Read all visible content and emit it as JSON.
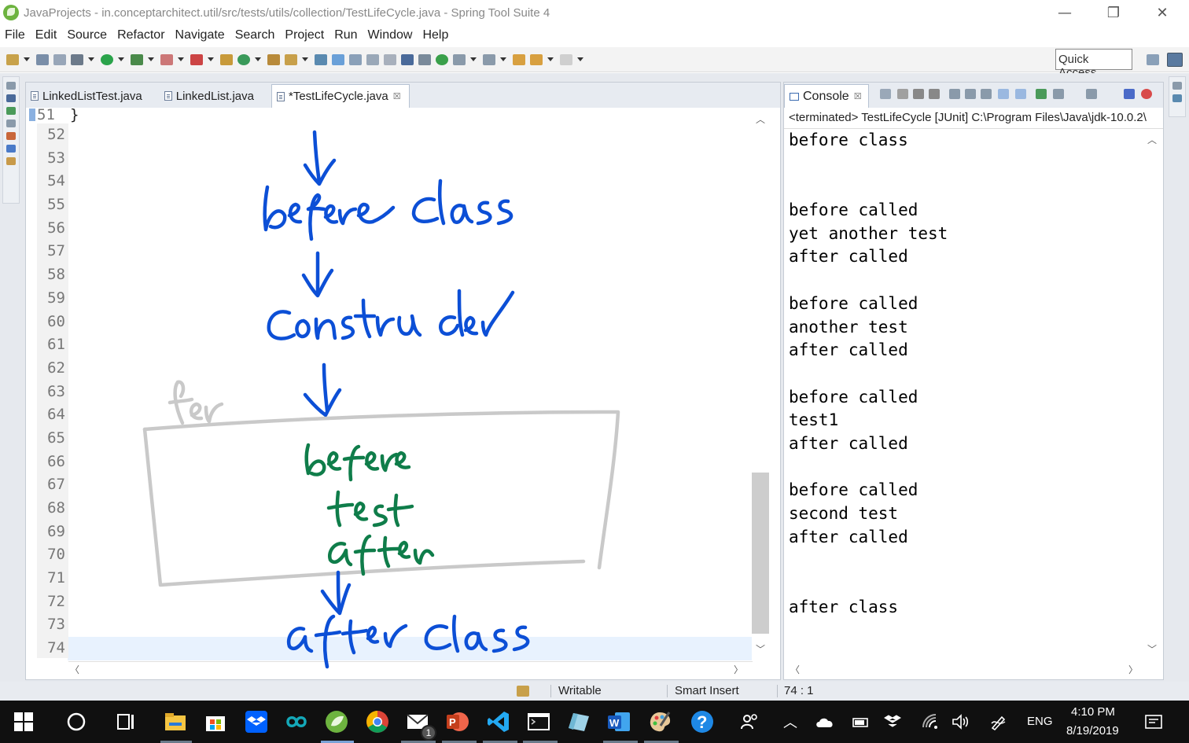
{
  "window": {
    "title": "JavaProjects - in.conceptarchitect.util/src/tests/utils/collection/TestLifeCycle.java - Spring Tool Suite 4",
    "minimize_glyph": "—",
    "restore_glyph": "❐",
    "close_glyph": "✕"
  },
  "menu": [
    "File",
    "Edit",
    "Source",
    "Refactor",
    "Navigate",
    "Search",
    "Project",
    "Run",
    "Window",
    "Help"
  ],
  "toolbar": {
    "quick_access": "Quick Access"
  },
  "editor": {
    "tabs": [
      {
        "label": "LinkedListTest.java"
      },
      {
        "label": "LinkedList.java"
      },
      {
        "label": "*TestLifeCycle.java"
      }
    ],
    "tab_close_glyph": "☒",
    "first_line_number": "51",
    "first_line_code": "}",
    "line_numbers": [
      "52",
      "53",
      "54",
      "55",
      "56",
      "57",
      "58",
      "59",
      "60",
      "61",
      "62",
      "63",
      "64",
      "65",
      "66",
      "67",
      "68",
      "69",
      "70",
      "71",
      "72",
      "73",
      "74"
    ]
  },
  "console": {
    "tab_label": "Console",
    "tab_close_glyph": "☒",
    "status": "<terminated> TestLifeCycle [JUnit] C:\\Program Files\\Java\\jdk-10.0.2\\",
    "lines": [
      "before class",
      "",
      "",
      "before called",
      "yet another test",
      "after called",
      "",
      "before called",
      "another test",
      "after called",
      "",
      "before called",
      "test1",
      "after called",
      "",
      "before called",
      "second test",
      "after called",
      "",
      "",
      "after class"
    ]
  },
  "statusbar": {
    "mode": "Writable",
    "insert": "Smart Insert",
    "position": "74 : 1"
  },
  "taskbar": {
    "time": "4:10 PM",
    "date": "8/19/2019",
    "language": "ENG",
    "badge": "1"
  },
  "colors": {
    "ink_blue": "#0c4fd6",
    "ink_green": "#0f7d4a",
    "ink_gray": "#c9c9c9",
    "spring_green": "#6db33f"
  }
}
